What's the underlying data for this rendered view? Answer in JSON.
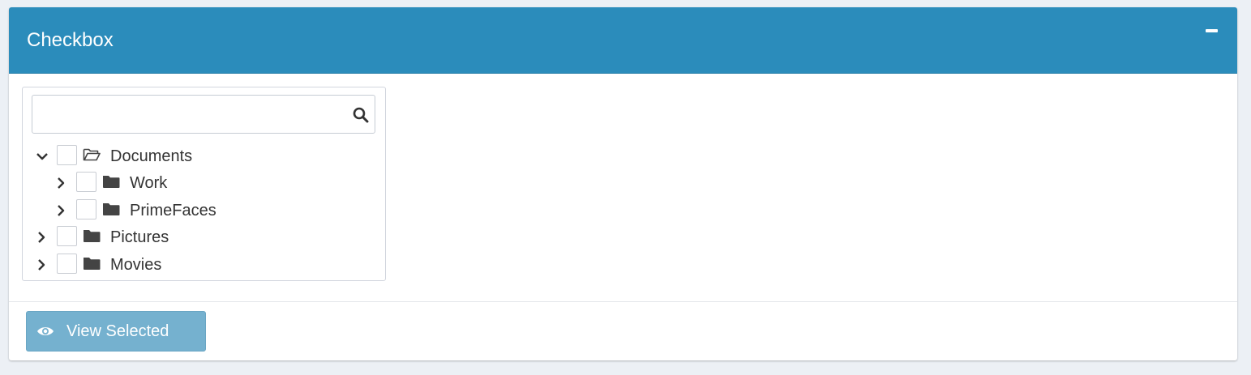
{
  "panel": {
    "title": "Checkbox",
    "collapse_icon": "minus-icon"
  },
  "tree": {
    "filter": {
      "value": "",
      "placeholder": "",
      "icon": "search-icon"
    },
    "nodes": [
      {
        "label": "Documents",
        "expanded": true,
        "checked": false,
        "icon": "folder-open-icon",
        "level": 0
      },
      {
        "label": "Work",
        "expanded": false,
        "checked": false,
        "icon": "folder-icon",
        "level": 1
      },
      {
        "label": "PrimeFaces",
        "expanded": false,
        "checked": false,
        "icon": "folder-icon",
        "level": 1
      },
      {
        "label": "Pictures",
        "expanded": false,
        "checked": false,
        "icon": "folder-icon",
        "level": 0
      },
      {
        "label": "Movies",
        "expanded": false,
        "checked": false,
        "icon": "folder-icon",
        "level": 0
      }
    ]
  },
  "footer": {
    "view_button_label": "View Selected",
    "view_button_icon": "eye-icon"
  },
  "colors": {
    "header": "#2b8cbb",
    "button": "#75b1cf",
    "background": "#ecf0f5"
  }
}
